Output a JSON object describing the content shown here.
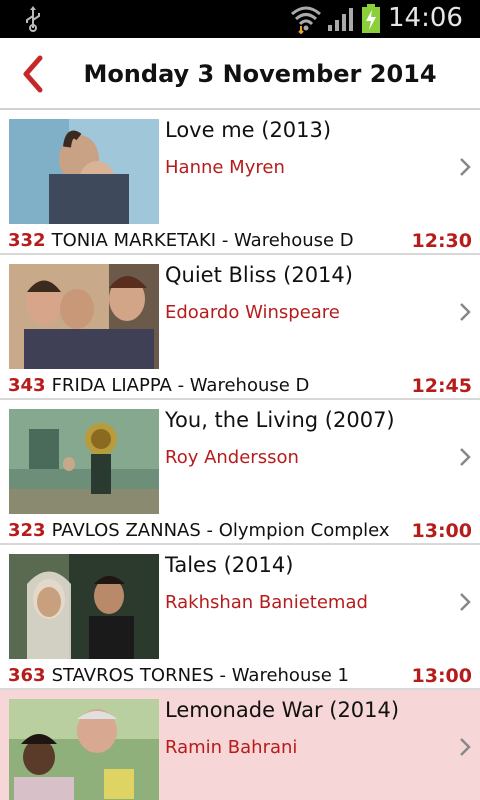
{
  "status_bar": {
    "time": "14:06",
    "icons": [
      "usb-icon",
      "wifi-icon",
      "signal-icon",
      "battery-charging-icon"
    ]
  },
  "header": {
    "title": "Monday 3 November 2014",
    "back_icon": "chevron-left-icon"
  },
  "colors": {
    "accent": "#b71c1c",
    "selected_row": "#f6d6d6",
    "status_bar": "#000000"
  },
  "films": [
    {
      "title": "Love me (2013)",
      "director": "Hanne Myren",
      "code": "332",
      "screening": "TONIA MARKETAKI - Warehouse D",
      "time": "12:30"
    },
    {
      "title": "Quiet Bliss (2014)",
      "director": "Edoardo Winspeare",
      "code": "343",
      "screening": "FRIDA LIAPPA - Warehouse D",
      "time": "12:45"
    },
    {
      "title": "You, the Living (2007)",
      "director": "Roy Andersson",
      "code": "323",
      "screening": "PAVLOS ZANNAS - Olympion Complex",
      "time": "13:00"
    },
    {
      "title": "Tales (2014)",
      "director": "Rakhshan Banietemad",
      "code": "363",
      "screening": "STAVROS TORNES - Warehouse 1",
      "time": "13:00"
    },
    {
      "title": "Lemonade War (2014)",
      "director": "Ramin Bahrani",
      "selected": true
    }
  ]
}
